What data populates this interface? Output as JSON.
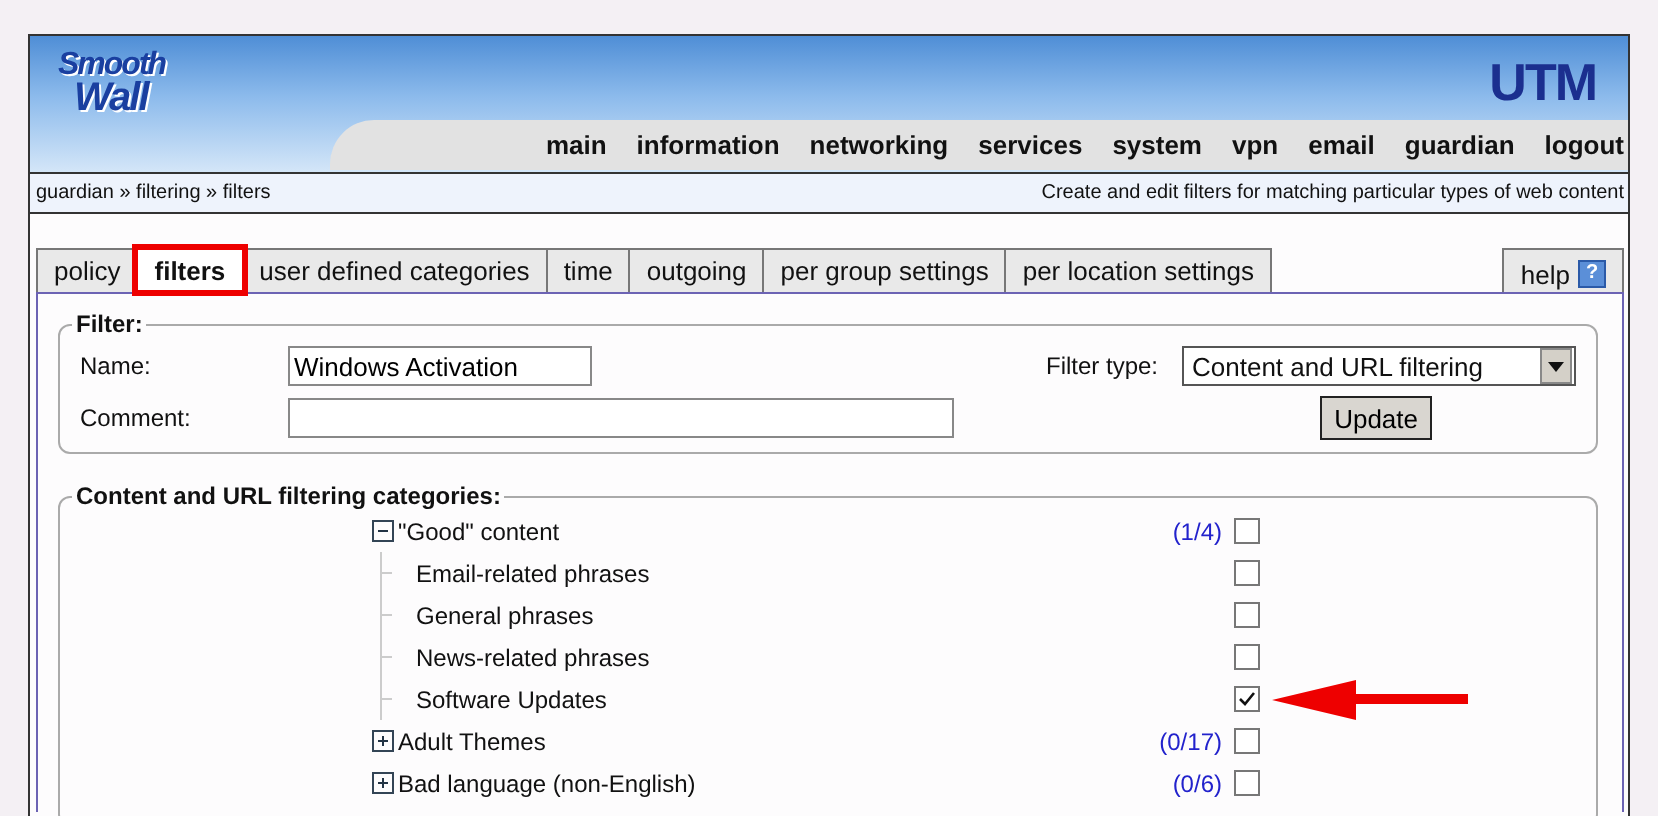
{
  "logo": {
    "line1": "Smooth",
    "line2": "Wall"
  },
  "product": "UTM",
  "nav": [
    "main",
    "information",
    "networking",
    "services",
    "system",
    "vpn",
    "email",
    "guardian",
    "logout"
  ],
  "breadcrumb": "guardian » filtering » filters",
  "page_description": "Create and edit filters for matching particular types of web content",
  "tabs": [
    {
      "label": "policy",
      "selected": false,
      "highlighted": false
    },
    {
      "label": "filters",
      "selected": true,
      "highlighted": true
    },
    {
      "label": "user defined categories",
      "selected": false,
      "highlighted": false
    },
    {
      "label": "time",
      "selected": false,
      "highlighted": false
    },
    {
      "label": "outgoing",
      "selected": false,
      "highlighted": false
    },
    {
      "label": "per group settings",
      "selected": false,
      "highlighted": false
    },
    {
      "label": "per location settings",
      "selected": false,
      "highlighted": false
    }
  ],
  "help_tab": {
    "label": "help",
    "icon": "?"
  },
  "filter": {
    "legend": "Filter:",
    "name_label": "Name:",
    "name_value": "Windows Activation",
    "comment_label": "Comment:",
    "type_label": "Filter type:",
    "type_value": "Content and URL filtering",
    "update_button": "Update"
  },
  "categories": {
    "legend": "Content and URL filtering categories:",
    "items": [
      {
        "label": "\"Good\" content",
        "count": "(1/4)",
        "checked": false,
        "expanded": true,
        "pointer_arrow": false,
        "children": [
          {
            "label": "Email-related phrases",
            "checked": false,
            "pointer_arrow": false
          },
          {
            "label": "General phrases",
            "checked": false,
            "pointer_arrow": false
          },
          {
            "label": "News-related phrases",
            "checked": false,
            "pointer_arrow": false
          },
          {
            "label": "Software Updates",
            "checked": true,
            "pointer_arrow": true
          }
        ]
      },
      {
        "label": "Adult Themes",
        "count": "(0/17)",
        "checked": false,
        "expanded": false,
        "pointer_arrow": false
      },
      {
        "label": "Bad language (non-English)",
        "count": "(0/6)",
        "checked": false,
        "expanded": false,
        "pointer_arrow": false
      }
    ]
  }
}
